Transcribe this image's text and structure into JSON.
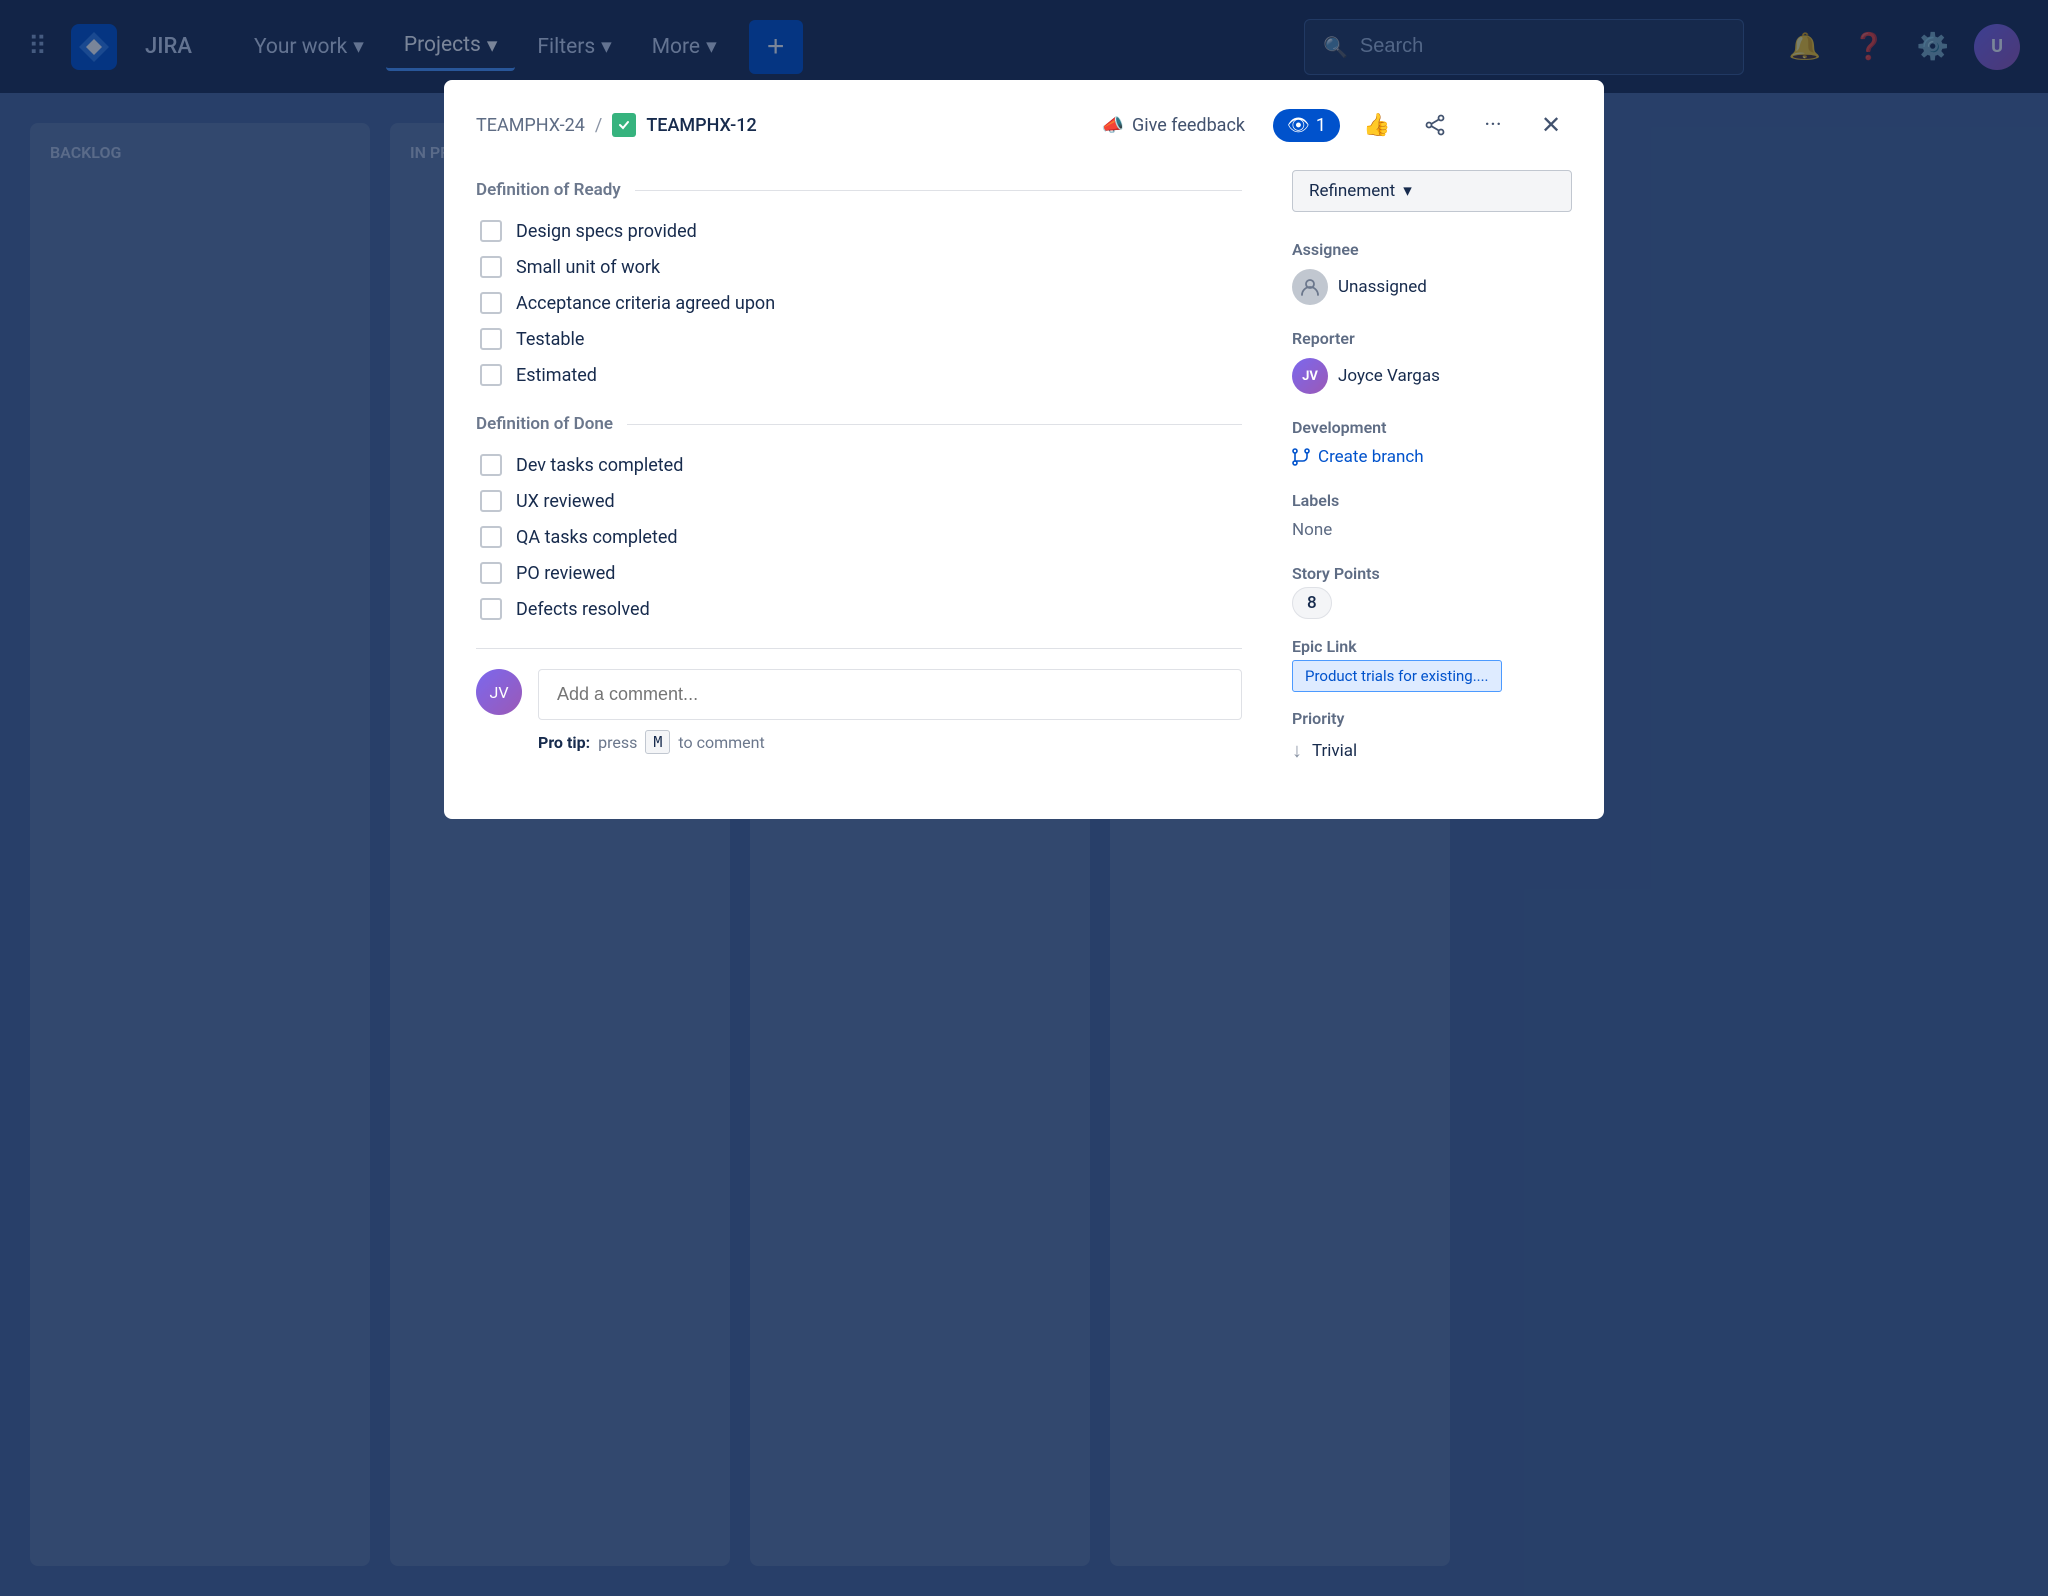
{
  "navbar": {
    "app_name": "JIRA",
    "nav_items": [
      {
        "id": "your-work",
        "label": "Your work",
        "active": false
      },
      {
        "id": "projects",
        "label": "Projects",
        "active": true
      },
      {
        "id": "filters",
        "label": "Filters",
        "active": false
      },
      {
        "id": "more",
        "label": "More",
        "active": false
      }
    ],
    "search_placeholder": "Search",
    "plus_label": "+"
  },
  "modal": {
    "breadcrumb_parent": "TEAMPHX-24",
    "breadcrumb_current": "TEAMPHX-12",
    "give_feedback": "Give feedback",
    "watch_count": "1",
    "refinement_label": "Refinement",
    "definition_of_ready": {
      "section_title": "Definition of Ready",
      "items": [
        {
          "id": "design-specs",
          "label": "Design specs provided",
          "checked": false
        },
        {
          "id": "small-unit",
          "label": "Small unit of work",
          "checked": false
        },
        {
          "id": "acceptance",
          "label": "Acceptance criteria agreed upon",
          "checked": false
        },
        {
          "id": "testable",
          "label": "Testable",
          "checked": false
        },
        {
          "id": "estimated",
          "label": "Estimated",
          "checked": false
        }
      ]
    },
    "definition_of_done": {
      "section_title": "Definition of Done",
      "items": [
        {
          "id": "dev-tasks",
          "label": "Dev tasks completed",
          "checked": false
        },
        {
          "id": "ux-reviewed",
          "label": "UX reviewed",
          "checked": false
        },
        {
          "id": "qa-tasks",
          "label": "QA tasks completed",
          "checked": false
        },
        {
          "id": "po-reviewed",
          "label": "PO reviewed",
          "checked": false
        },
        {
          "id": "defects",
          "label": "Defects resolved",
          "checked": false
        }
      ]
    },
    "comment_placeholder": "Add a comment...",
    "pro_tip_text": "Pro tip:",
    "pro_tip_key": "M",
    "pro_tip_suffix": "to comment",
    "sidebar": {
      "assignee_label": "Assignee",
      "assignee_value": "Unassigned",
      "reporter_label": "Reporter",
      "reporter_value": "Joyce Vargas",
      "reporter_initials": "JV",
      "development_label": "Development",
      "create_branch_label": "Create branch",
      "labels_label": "Labels",
      "labels_value": "None",
      "story_points_label": "Story Points",
      "story_points_value": "8",
      "epic_link_label": "Epic Link",
      "epic_link_value": "Product trials for existing....",
      "priority_label": "Priority",
      "priority_value": "Trivial"
    }
  }
}
